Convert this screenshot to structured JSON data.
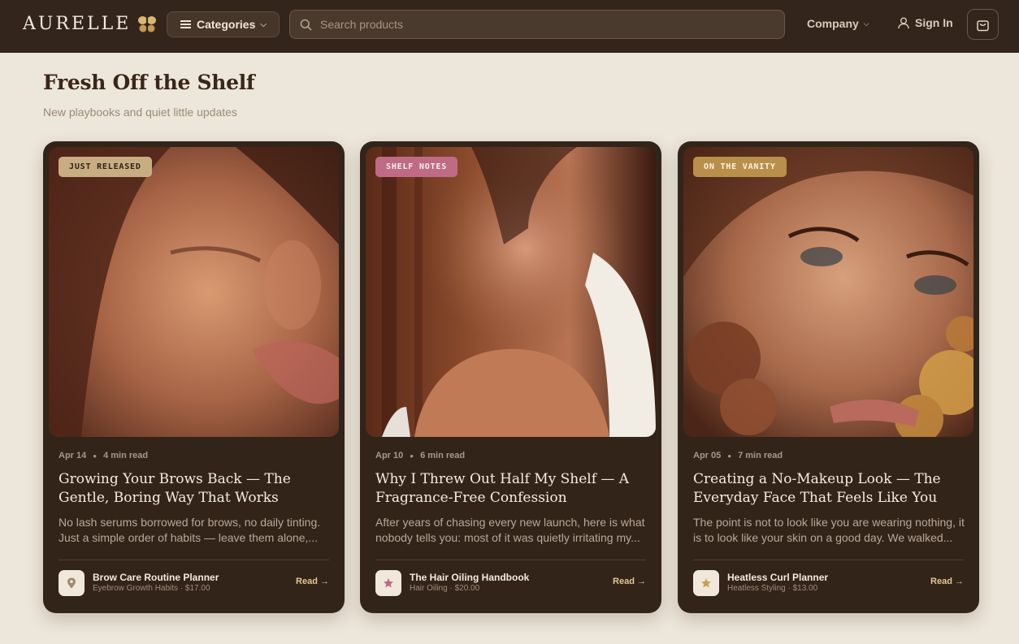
{
  "header": {
    "logo": "AURELLE",
    "categories_label": "Categories",
    "search_placeholder": "Search products",
    "company_label": "Company",
    "signin_label": "Sign In"
  },
  "section": {
    "title": "Fresh Off the Shelf",
    "subtitle": "New playbooks and quiet little updates"
  },
  "cards": [
    {
      "badge": "JUST RELEASED",
      "badge_bg": "#c9ad82",
      "badge_fg": "#2e2118",
      "date": "Apr 14",
      "read_time": "4 min read",
      "title": "Growing Your Brows Back — The Gentle, Boring Way That Works",
      "excerpt_1": "No lash serums borrowed for brows, no daily tinting.",
      "excerpt_2": "Just a simple order of habits — leave them alone,...",
      "product_name": "Brow Care Routine Planner",
      "product_sub": "Eyebrow Growth Habits · $17.00",
      "product_icon": "map-pin-icon",
      "icon_color": "#a08a74",
      "read_label": "Read →"
    },
    {
      "badge": "SHELF NOTES",
      "badge_bg": "#c06b85",
      "badge_fg": "#fbeef2",
      "date": "Apr 10",
      "read_time": "6 min read",
      "title": "Why I Threw Out Half My Shelf — A Fragrance-Free Confession",
      "excerpt_1": "After years of chasing every new launch, here is what",
      "excerpt_2": "nobody tells you: most of it was quietly irritating my...",
      "product_name": "The Hair Oiling Handbook",
      "product_sub": "Hair Oiling · $20.00",
      "product_icon": "star-icon",
      "icon_color": "#c06b85",
      "read_label": "Read →"
    },
    {
      "badge": "ON THE VANITY",
      "badge_bg": "#b98f4c",
      "badge_fg": "#fff3dd",
      "date": "Apr 05",
      "read_time": "7 min read",
      "title": "Creating a No-Makeup Look — The Everyday Face That Feels Like You",
      "excerpt_1": "The point is not to look like you are wearing nothing, it",
      "excerpt_2": "is to look like your skin on a good day. We walked...",
      "product_name": "Heatless Curl Planner",
      "product_sub": "Heatless Styling · $13.00",
      "product_icon": "star-icon",
      "icon_color": "#c9a24f",
      "read_label": "Read →"
    }
  ]
}
